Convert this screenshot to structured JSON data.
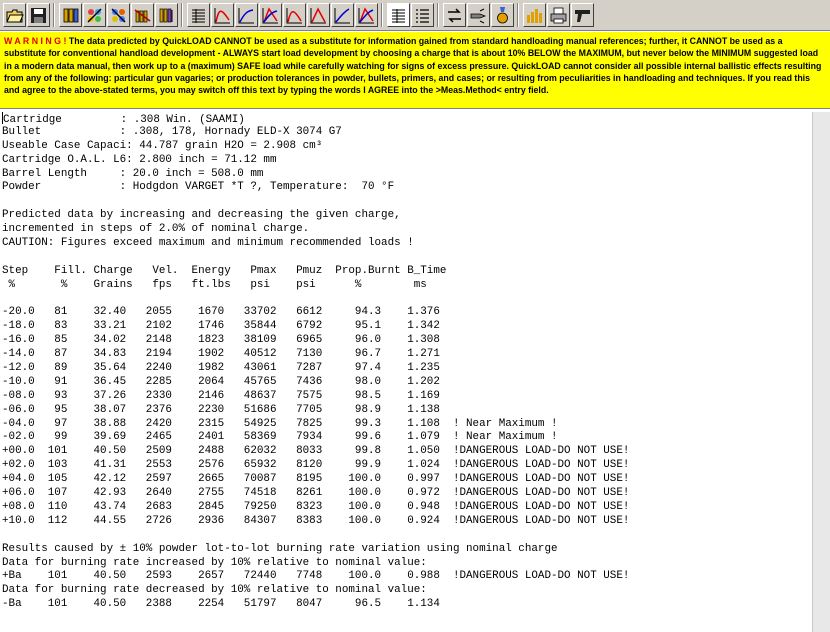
{
  "toolbar": {
    "buttons": [
      {
        "icon": "open-folder-icon"
      },
      {
        "icon": "save-disk-icon"
      },
      {
        "icon": "cartridge-icon"
      },
      {
        "icon": "propellant-icon"
      },
      {
        "icon": "cartridge-propellant-icon"
      },
      {
        "icon": "rifle-cartridge-icon"
      },
      {
        "icon": "cartridge-list-icon"
      },
      {
        "icon": "data-table-icon"
      },
      {
        "icon": "pressure-chart-icon"
      },
      {
        "icon": "velocity-chart-icon"
      },
      {
        "icon": "energy-chart-icon"
      },
      {
        "icon": "pressure-time-chart-icon"
      },
      {
        "icon": "burn-chart-icon"
      },
      {
        "icon": "combined-chart-icon"
      },
      {
        "icon": "report-table-icon"
      },
      {
        "icon": "report-list-icon"
      },
      {
        "icon": "transfer-icon"
      },
      {
        "icon": "bullet-icon"
      },
      {
        "icon": "medal-icon"
      },
      {
        "icon": "bar-graph-icon"
      },
      {
        "icon": "print-icon"
      },
      {
        "icon": "pistol-icon"
      }
    ]
  },
  "warning": {
    "title": "W A R N I N G !",
    "text": " The data predicted by QuickLOAD CANNOT be used as a substitute for information gained from standard handloading manual references; further, it CANNOT be used as a substitute for conventional handload development - ALWAYS start load development by choosing a charge that is about 10% BELOW the MAXIMUM, but never below the MINIMUM suggested load in a modern data manual, then work up to a (maximum) SAFE load while carefully watching for signs of excess pressure. QuickLOAD cannot consider all possible internal ballistic effects resulting from any of the following: particular gun vagaries; or production tolerances in powder, bullets, primers, and cases; or resulting from peculiarities in handloading and techniques. If you read this and agree to the above-stated terms, you may switch off this text by typing the words I AGREE into the >Meas.Method< entry field."
  },
  "report": {
    "lines": [
      "Cartridge         : .308 Win. (SAAMI)",
      "Bullet            : .308, 178, Hornady ELD-X 3074 G7",
      "Useable Case Capaci: 44.787 grain H2O = 2.908 cm³",
      "Cartridge O.A.L. L6: 2.800 inch = 71.12 mm",
      "Barrel Length     : 20.0 inch = 508.0 mm",
      "Powder            : Hodgdon VARGET *T ?, Temperature:  70 °F",
      "",
      "Predicted data by increasing and decreasing the given charge,",
      "incremented in steps of 2.0% of nominal charge.",
      "CAUTION: Figures exceed maximum and minimum recommended loads !",
      "",
      "Step    Fill. Charge   Vel.  Energy   Pmax   Pmuz  Prop.Burnt B_Time",
      " %       %    Grains   fps   ft.lbs   psi    psi      %        ms",
      "",
      "-20.0   81    32.40   2055    1670   33702   6612     94.3    1.376",
      "-18.0   83    33.21   2102    1746   35844   6792     95.1    1.342",
      "-16.0   85    34.02   2148    1823   38109   6965     96.0    1.308",
      "-14.0   87    34.83   2194    1902   40512   7130     96.7    1.271",
      "-12.0   89    35.64   2240    1982   43061   7287     97.4    1.235",
      "-10.0   91    36.45   2285    2064   45765   7436     98.0    1.202",
      "-08.0   93    37.26   2330    2146   48637   7575     98.5    1.169",
      "-06.0   95    38.07   2376    2230   51686   7705     98.9    1.138",
      "-04.0   97    38.88   2420    2315   54925   7825     99.3    1.108  ! Near Maximum !",
      "-02.0   99    39.69   2465    2401   58369   7934     99.6    1.079  ! Near Maximum !",
      "+00.0  101    40.50   2509    2488   62032   8033     99.8    1.050  !DANGEROUS LOAD-DO NOT USE!",
      "+02.0  103    41.31   2553    2576   65932   8120     99.9    1.024  !DANGEROUS LOAD-DO NOT USE!",
      "+04.0  105    42.12   2597    2665   70087   8195    100.0    0.997  !DANGEROUS LOAD-DO NOT USE!",
      "+06.0  107    42.93   2640    2755   74518   8261    100.0    0.972  !DANGEROUS LOAD-DO NOT USE!",
      "+08.0  110    43.74   2683    2845   79250   8323    100.0    0.948  !DANGEROUS LOAD-DO NOT USE!",
      "+10.0  112    44.55   2726    2936   84307   8383    100.0    0.924  !DANGEROUS LOAD-DO NOT USE!",
      "",
      "Results caused by ± 10% powder lot-to-lot burning rate variation using nominal charge",
      "Data for burning rate increased by 10% relative to nominal value:",
      "+Ba    101    40.50   2593    2657   72440   7748    100.0    0.988  !DANGEROUS LOAD-DO NOT USE!",
      "Data for burning rate decreased by 10% relative to nominal value:",
      "-Ba    101    40.50   2388    2254   51797   8047     96.5    1.134"
    ]
  }
}
